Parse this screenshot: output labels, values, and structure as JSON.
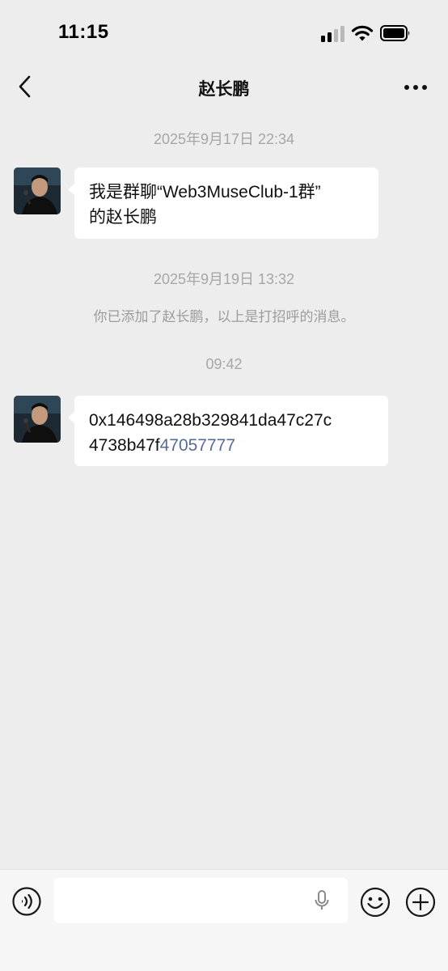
{
  "status_bar": {
    "time": "11:15"
  },
  "nav": {
    "title": "赵长鹏",
    "back_icon": "chevron-left-icon",
    "more_icon": "more-dots-icon"
  },
  "chat": {
    "timestamp_1": "2025年9月17日 22:34",
    "message_1": {
      "line1": "我是群聊“Web3MuseClub-1群”",
      "line2": "的赵长鹏"
    },
    "timestamp_2": "2025年9月19日 13:32",
    "system_notice": "你已添加了赵长鹏，以上是打招呼的消息。",
    "timestamp_3": "09:42",
    "message_2": {
      "line1": "0x146498a28b329841da47c27c",
      "line2_plain": "4738b47f",
      "line2_link": "47057777"
    }
  },
  "input_bar": {
    "voice_icon": "voice-mode-icon",
    "mic_icon": "microphone-icon",
    "emoji_icon": "emoji-icon",
    "plus_icon": "plus-circle-icon",
    "text_value": ""
  },
  "colors": {
    "background": "#ededed",
    "bubble": "#ffffff",
    "link": "#576b95",
    "timestamp": "#a6a6a6"
  }
}
